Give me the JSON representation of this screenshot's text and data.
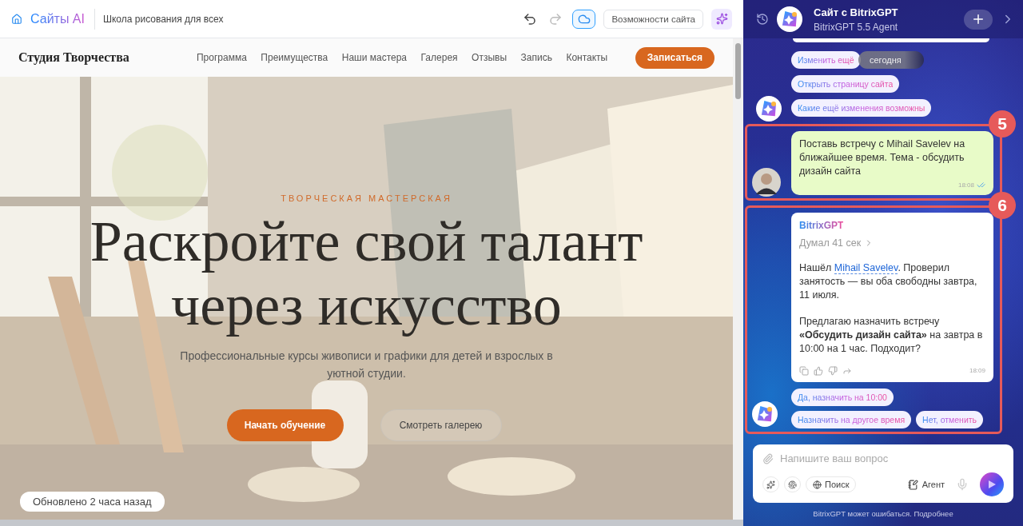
{
  "topbar": {
    "logo": "Сайты AI",
    "site_name": "Школа рисования для всех",
    "features_button": "Возможности сайта"
  },
  "site": {
    "brand": "Студия Творчества",
    "nav": [
      "Программа",
      "Преимущества",
      "Наши мастера",
      "Галерея",
      "Отзывы",
      "Запись",
      "Контакты"
    ],
    "cta": "Записаться",
    "hero": {
      "kind": "picture",
      "kicker": "ТВОРЧЕСКАЯ МАСТЕРСКАЯ",
      "title_lines": [
        "Раскройте свой талант",
        "через искусство"
      ],
      "subtitle": "Профессиональные курсы живописи и графики для детей и взрослых в уютной студии.",
      "primary_button": "Начать обучение",
      "secondary_button": "Смотреть галерею"
    },
    "updated": "Обновлено 2 часа назад"
  },
  "chat": {
    "title": "Сайт с BitrixGPT",
    "subtitle": "BitrixGPT 5.5 Agent",
    "date_pill": "сегодня",
    "messages": [
      {
        "kind": "chips",
        "chips": [
          "Изменить ещё",
          "Открыть страницу сайта",
          "Какие ещё изменения возможны"
        ]
      },
      {
        "kind": "user",
        "annotation": "5",
        "text": "Поставь встречу с Mihail Savelev на ближайшее время. Тема - обсудить дизайн сайта",
        "time": "18:08"
      },
      {
        "kind": "bot",
        "annotation": "6",
        "author": "BitrixGPT",
        "thinking": "Думал 41 сек",
        "intro": {
          "before": "Нашёл ",
          "link": "Mihail Savelev",
          "after": ". Проверил занятость — вы оба свободны завтра, 11 июля."
        },
        "body": "Предлагаю назначить встречу **«Обсудить дизайн сайта»** на завтра в 10:00 на 1 час. Подходит?",
        "time": "18:09",
        "chips": [
          "Да, назначить на 10:00",
          "Назначить на другое время",
          "Нет, отменить"
        ]
      }
    ]
  },
  "composer": {
    "placeholder": "Напишите ваш вопрос",
    "search": "Поиск",
    "agent": "Агент"
  },
  "disclaimer": "BitrixGPT может ошибаться. Подробнее"
}
